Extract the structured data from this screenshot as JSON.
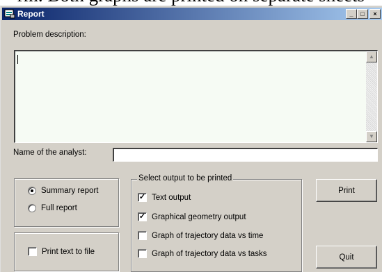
{
  "background_text": "rm. Both graphs are printed on separate sheets",
  "window": {
    "title": "Report",
    "icon": "report-app-icon",
    "controls": {
      "minimize": "_",
      "maximize": "□",
      "close": "×"
    }
  },
  "problem": {
    "label": "Problem description:",
    "value": ""
  },
  "analyst": {
    "label": "Name of the analyst:",
    "value": ""
  },
  "report_type": {
    "options": [
      {
        "label": "Summary report",
        "selected": true
      },
      {
        "label": "Full report",
        "selected": false
      }
    ]
  },
  "print_to_file": {
    "label": "Print text to file",
    "checked": false
  },
  "output": {
    "caption": "Select output to be printed",
    "items": [
      {
        "label": "Text output",
        "checked": true
      },
      {
        "label": "Graphical geometry output",
        "checked": true
      },
      {
        "label": "Graph of trajectory data vs time",
        "checked": false
      },
      {
        "label": "Graph of trajectory data vs tasks",
        "checked": false
      }
    ]
  },
  "buttons": {
    "print": "Print",
    "quit": "Quit"
  }
}
